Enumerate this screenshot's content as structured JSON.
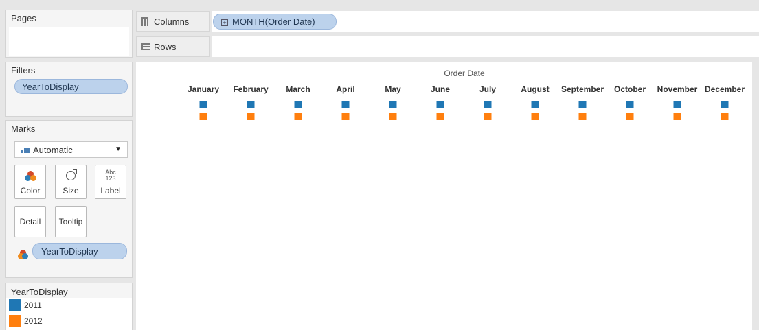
{
  "cards": {
    "pages": {
      "title": "Pages"
    },
    "filters": {
      "title": "Filters",
      "pill": "YearToDisplay"
    },
    "marks": {
      "title": "Marks",
      "mark_type": "Automatic",
      "buttons": {
        "color": "Color",
        "size": "Size",
        "label": "Label",
        "label_icon_top": "Abc",
        "label_icon_bottom": "123",
        "detail": "Detail",
        "tooltip": "Tooltip"
      },
      "color_pill": "YearToDisplay"
    },
    "legend": {
      "title": "YearToDisplay",
      "items": [
        {
          "label": "2011",
          "color": "#1f77b4"
        },
        {
          "label": "2012",
          "color": "#ff7f0e"
        }
      ]
    }
  },
  "shelves": {
    "columns": {
      "label": "Columns",
      "pill": "MONTH(Order Date)"
    },
    "rows": {
      "label": "Rows"
    }
  },
  "viz": {
    "title": "Order Date",
    "months": [
      "January",
      "February",
      "March",
      "April",
      "May",
      "June",
      "July",
      "August",
      "September",
      "October",
      "November",
      "December"
    ],
    "series": [
      {
        "name": "2011",
        "color": "#1f77b4"
      },
      {
        "name": "2012",
        "color": "#ff7f0e"
      }
    ]
  }
}
